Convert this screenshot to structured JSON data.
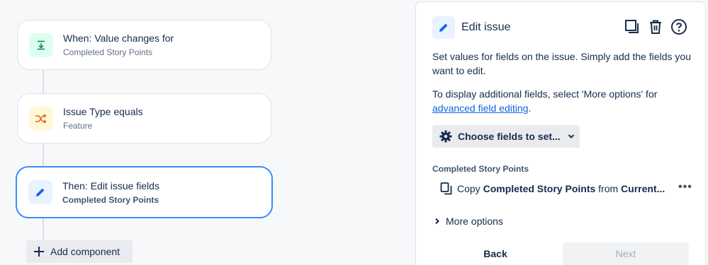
{
  "rule": {
    "trigger": {
      "title": "When: Value changes for",
      "subtitle": "Completed Story Points",
      "icon": "field-change-icon",
      "color": "#1f845a"
    },
    "condition": {
      "title": "Issue Type equals",
      "subtitle": "Feature",
      "icon": "shuffle-icon",
      "color": "#e56910"
    },
    "action": {
      "title": "Then: Edit issue fields",
      "subtitle": "Completed Story Points",
      "icon": "pencil-icon",
      "color": "#0c66e4"
    },
    "add_component_label": "Add component"
  },
  "panel": {
    "title": "Edit issue",
    "actions": [
      "copy-icon",
      "trash-icon",
      "help-icon"
    ],
    "description_1": "Set values for fields on the issue. Simply add the fields you want to edit.",
    "description_2_prefix": "To display additional fields, select 'More options' for ",
    "description_2_link": "advanced field editing",
    "description_2_suffix": ".",
    "choose_fields_label": "Choose fields to set...",
    "field_label": "Completed Story Points",
    "field_value": {
      "verb": "Copy",
      "field": "Completed Story Points",
      "from_word": "from",
      "source": "Current..."
    },
    "more_options_label": "More options",
    "back_label": "Back",
    "next_label": "Next"
  },
  "colors": {
    "accent": "#388bff",
    "link": "#0c66e4",
    "text": "#172b4d"
  }
}
